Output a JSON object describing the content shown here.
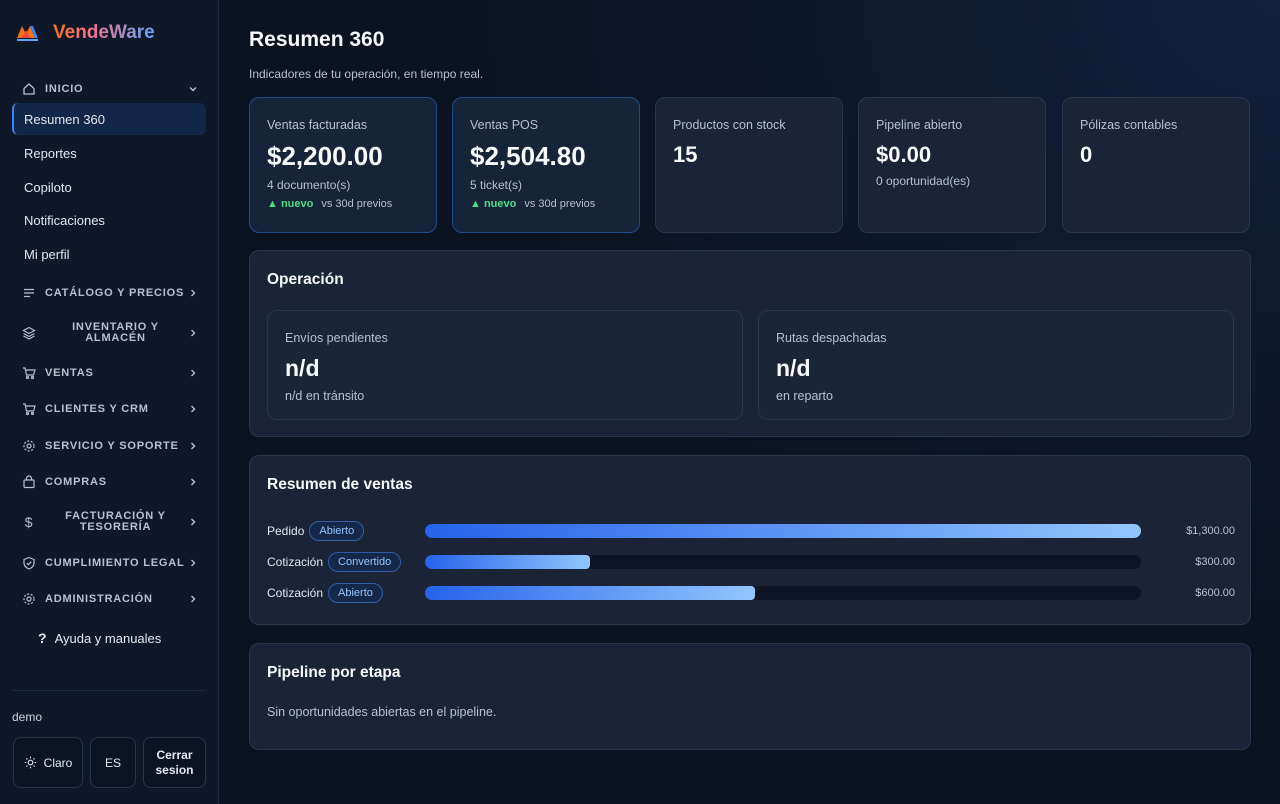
{
  "brand": {
    "name": "VendeWare"
  },
  "sidebar": {
    "groups": {
      "inicio": "INICIO",
      "catalogo": "CATÁLOGO Y PRECIOS",
      "inventario_l1": "INVENTARIO Y",
      "inventario_l2": "ALMACÉN",
      "ventas": "VENTAS",
      "clientes": "CLIENTES Y CRM",
      "servicio": "SERVICIO Y SOPORTE",
      "compras": "COMPRAS",
      "facturacion_l1": "FACTURACIÓN Y",
      "facturacion_l2": "TESORERÍA",
      "cumplimiento": "CUMPLIMIENTO LEGAL",
      "administracion": "ADMINISTRACIÓN"
    },
    "items": [
      "Resumen 360",
      "Reportes",
      "Copiloto",
      "Notificaciones",
      "Mi perfil"
    ],
    "help": "Ayuda y manuales",
    "user": "demo",
    "buttons": {
      "theme": "Claro",
      "lang": "ES",
      "logout_l1": "Cerrar",
      "logout_l2": "sesion"
    }
  },
  "header": {
    "title": "Resumen 360",
    "subtitle": "Indicadores de tu operación, en tiempo real."
  },
  "kpis": [
    {
      "label": "Ventas facturadas",
      "value": "$2,200.00",
      "sub": "4 documento(s)",
      "trend": "▲ nuevo",
      "trend_note": "vs 30d previos"
    },
    {
      "label": "Ventas POS",
      "value": "$2,504.80",
      "sub": "5 ticket(s)",
      "trend": "▲ nuevo",
      "trend_note": "vs 30d previos"
    },
    {
      "label": "Productos con stock",
      "value": "15"
    },
    {
      "label": "Pipeline abierto",
      "value": "$0.00",
      "sub": "0 oportunidad(es)"
    },
    {
      "label": "Pólizas contables",
      "value": "0"
    }
  ],
  "operacion": {
    "title": "Operación",
    "cards": [
      {
        "label": "Envíos pendientes",
        "value": "n/d",
        "sub": "n/d en tránsito"
      },
      {
        "label": "Rutas despachadas",
        "value": "n/d",
        "sub": "en reparto"
      }
    ]
  },
  "ventas": {
    "title": "Resumen de ventas",
    "rows": [
      {
        "type": "Pedido",
        "status": "Abierto",
        "amount": "$1,300.00",
        "value": 1300
      },
      {
        "type": "Cotización",
        "status": "Convertido",
        "amount": "$300.00",
        "value": 300
      },
      {
        "type": "Cotización",
        "status": "Abierto",
        "amount": "$600.00",
        "value": 600
      }
    ],
    "max": 1300
  },
  "pipeline": {
    "title": "Pipeline por etapa",
    "empty": "Sin oportunidades abiertas en el pipeline."
  },
  "colors": {
    "accent": "#3b82f6",
    "positive": "#4ade80",
    "background": "#0b1220",
    "card": "#1a2436"
  }
}
